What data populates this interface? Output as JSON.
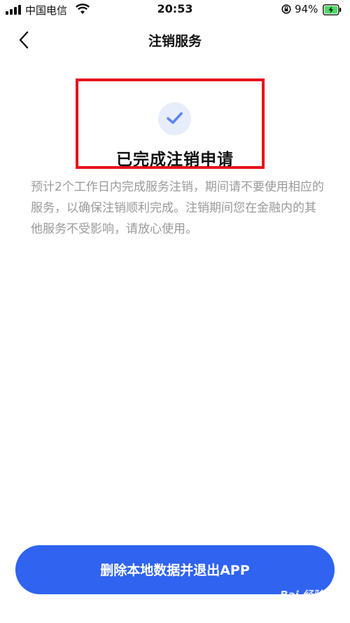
{
  "status_bar": {
    "carrier": "中国电信",
    "time": "20:53",
    "battery_percent": "94%",
    "icons": [
      "signal-icon",
      "wifi-icon",
      "rotation-lock-icon",
      "battery-charging-icon"
    ]
  },
  "nav": {
    "back_icon": "chevron-left-icon",
    "title": "注销服务"
  },
  "result": {
    "icon": "check-icon",
    "title": "已完成注销申请",
    "description": "预计2个工作日内完成服务注销，期间请不要使用相应的服务，以确保注销顺利完成。注销期间您在金融内的其他服务不受影响，请放心使用。"
  },
  "footer": {
    "button_label": "删除本地数据并退出APP"
  },
  "watermark": "Bai 经验",
  "colors": {
    "accent": "#2f63f0",
    "highlight_border": "#e8121c",
    "check_bg": "#e7edfa",
    "check_mark": "#5b86f0",
    "body_text": "#9a9a9a",
    "battery_green": "#4cd964"
  }
}
